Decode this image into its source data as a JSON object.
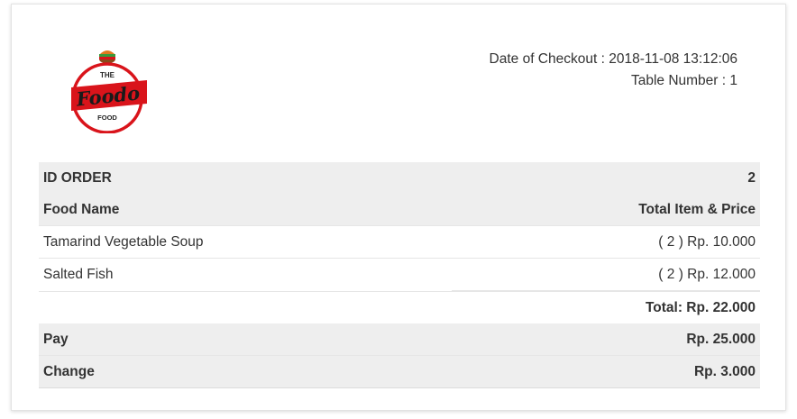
{
  "logo": {
    "top_text": "THE",
    "brand": "Foodo",
    "bottom_text": "FOOD",
    "color": "#d9141b"
  },
  "checkout": {
    "date_label": "Date of Checkout : ",
    "date_value": "2018-11-08 13:12:06",
    "table_label": "Table Number : ",
    "table_value": "1"
  },
  "order": {
    "id_label": "ID ORDER",
    "id_value": "2",
    "col_food": "Food Name",
    "col_total": "Total Item & Price",
    "items": [
      {
        "name": "Tamarind Vegetable Soup",
        "qty_price": "( 2 ) Rp. 10.000"
      },
      {
        "name": "Salted Fish",
        "qty_price": "( 2 ) Rp. 12.000"
      }
    ],
    "total": "Total: Rp. 22.000",
    "pay_label": "Pay",
    "pay_value": "Rp. 25.000",
    "change_label": "Change",
    "change_value": "Rp. 3.000"
  }
}
